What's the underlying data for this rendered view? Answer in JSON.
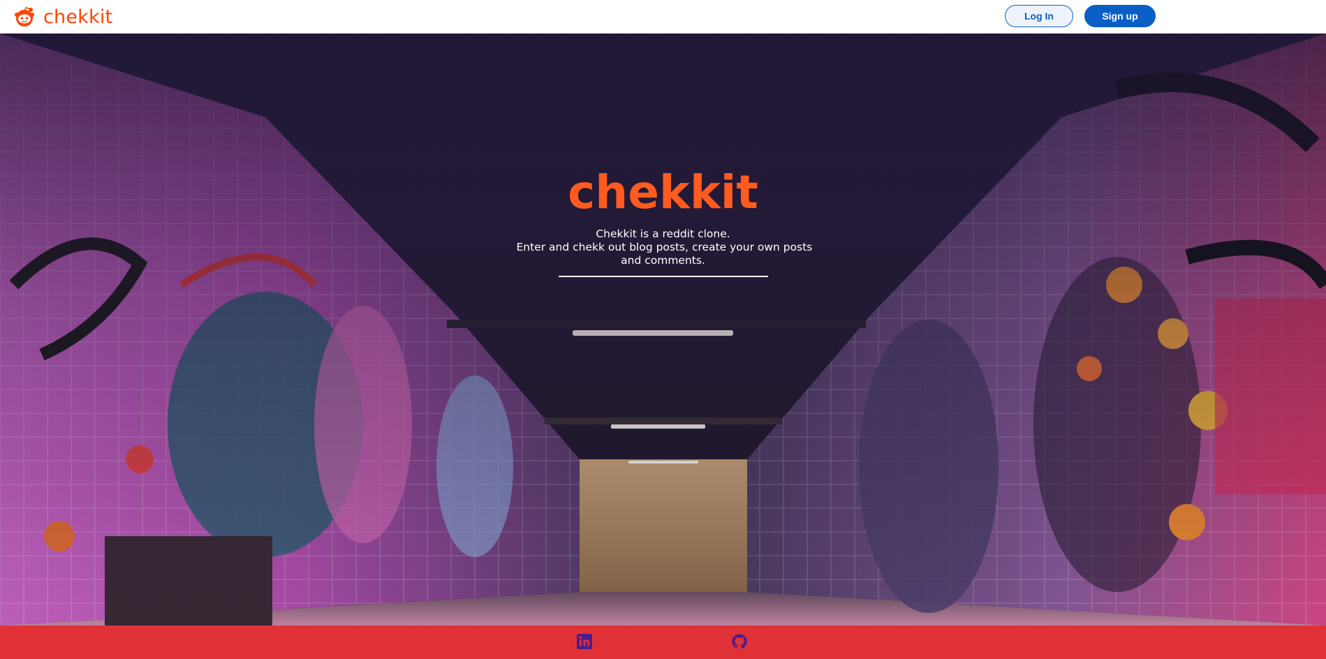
{
  "navbar": {
    "brand_name": "chekkit",
    "brand_icon": "reddit-alien-icon",
    "login_label": "Log In",
    "signup_label": "Sign up"
  },
  "hero": {
    "title": "chekkit",
    "description_lines": [
      "Chekkit is a reddit clone.",
      "Enter and chekk out blog posts, create your own posts",
      "and comments."
    ],
    "background": "graffiti-tunnel-photo"
  },
  "footer": {
    "links": [
      {
        "icon": "linkedin-icon"
      },
      {
        "icon": "github-icon"
      }
    ]
  },
  "colors": {
    "brand_orange": "#ff4500",
    "button_blue": "#0a5fc7",
    "footer_red": "#e03236",
    "icon_purple": "#4b1c8c"
  }
}
